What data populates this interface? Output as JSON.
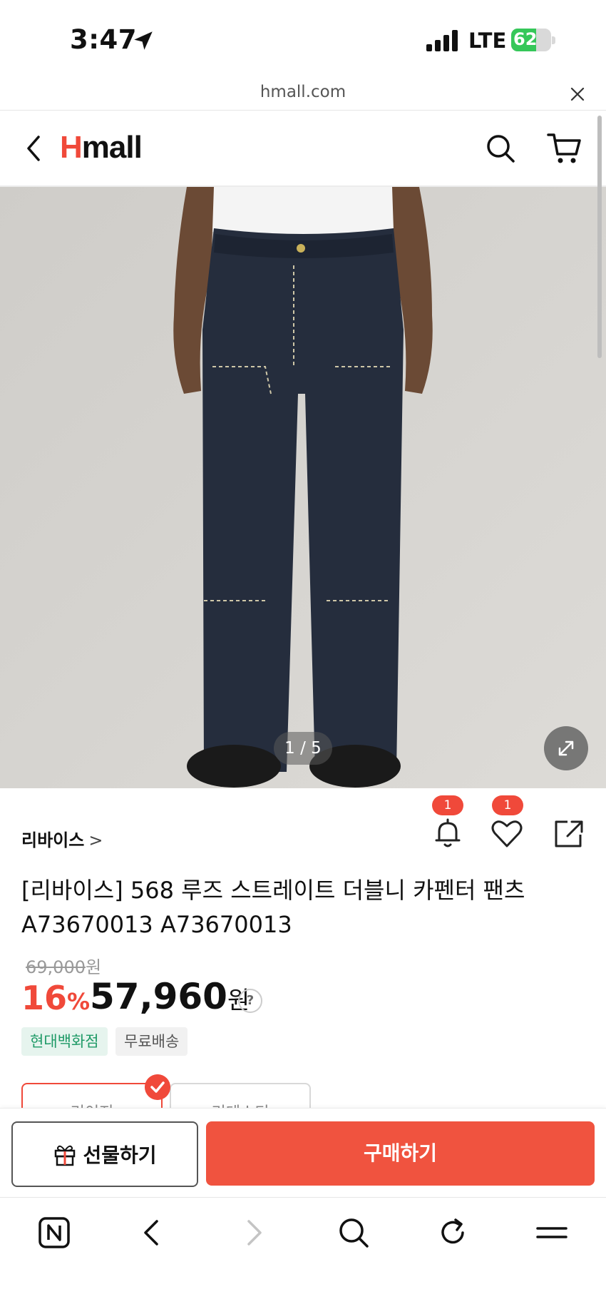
{
  "status": {
    "time": "3:47",
    "network": "LTE",
    "battery": "62",
    "battery_level": 0.62
  },
  "browser": {
    "url": "hmall.com"
  },
  "header": {
    "logo_h": "H",
    "logo_rest": "mall"
  },
  "gallery": {
    "counter": "1 / 5"
  },
  "product": {
    "brand": "리바이스",
    "brand_chevron": ">",
    "alarm_count": "1",
    "wish_count": "1",
    "title": "[리바이스] 568 루즈 스트레이트 더블니 카펜터 팬츠 A73670013 A73670013",
    "original_price": "69,000",
    "original_unit": "원",
    "discount": "16",
    "discount_unit": "%",
    "sale_price": "57,960",
    "sale_unit": "원",
    "info_symbol": "?"
  },
  "tags": {
    "store": "현대백화점",
    "shipping": "무료배송"
  },
  "options": {
    "option_a": "리이지",
    "option_b": "리테스티"
  },
  "cta": {
    "gift_label": "선물하기",
    "buy_label": "구매하기"
  },
  "colors": {
    "accent": "#f0493a",
    "store_tag": "#1f9a67"
  }
}
